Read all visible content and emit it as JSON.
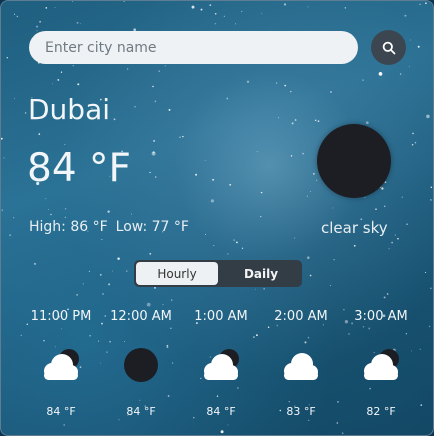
{
  "search": {
    "placeholder": "Enter city name",
    "button_icon": "search-icon"
  },
  "current": {
    "city": "Dubai",
    "temperature": "84 °F",
    "high": "High: 86 °F",
    "low": "Low: 77 °F",
    "description": "clear sky",
    "icon": "moon-icon"
  },
  "toggle": {
    "hourly_label": "Hourly",
    "daily_label": "Daily",
    "active": "hourly"
  },
  "hourly": [
    {
      "time": "11:00 PM",
      "icon": "cloud-moon-icon",
      "temp": "84 °F"
    },
    {
      "time": "12:00 AM",
      "icon": "moon-icon",
      "temp": "84 °F"
    },
    {
      "time": "1:00 AM",
      "icon": "cloud-moon-icon",
      "temp": "84 °F"
    },
    {
      "time": "2:00 AM",
      "icon": "cloud-icon",
      "temp": "83 °F"
    },
    {
      "time": "3:00 AM",
      "icon": "cloud-moon-icon",
      "temp": "82 °F"
    }
  ]
}
